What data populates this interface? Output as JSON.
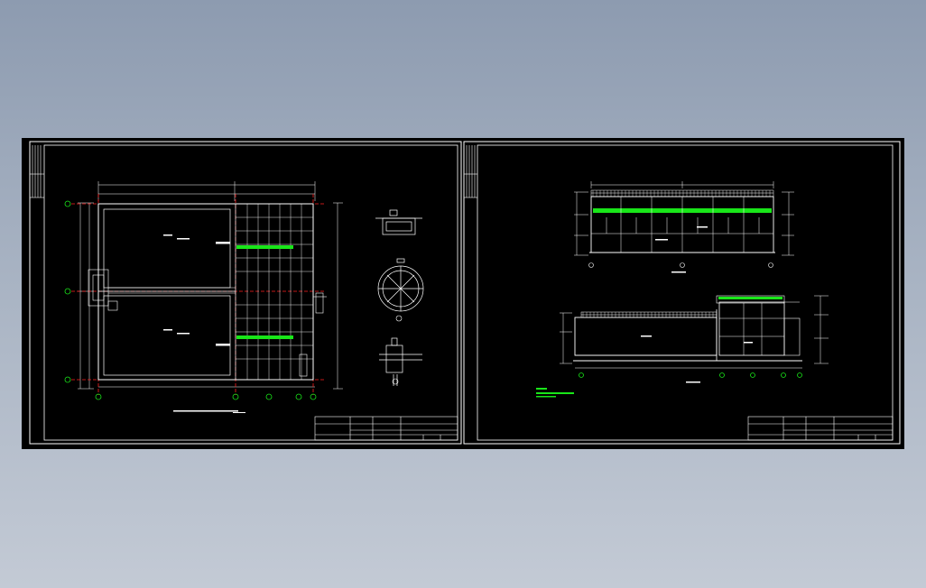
{
  "colors": {
    "background_top": "#8d9bb0",
    "background_bottom": "#c3cad5",
    "canvas": "#000000",
    "frame": "#ffffff",
    "axis_lines": "#ff2020",
    "fill_highlight": "#19e619",
    "annotation_text": "#19e619"
  },
  "icons": {
    "detail_circle": "circle-detail-icon",
    "axis_bubble": "axis-bubble-icon"
  },
  "sheets": [
    {
      "id": "sheet-1",
      "content": "tank-plan",
      "details": [
        "section-detail",
        "circular-manhole-detail",
        "pipe-fitting-detail"
      ]
    },
    {
      "id": "sheet-2",
      "content": "tank-elevations",
      "views": [
        "longitudinal-section",
        "cross-section"
      ]
    }
  ]
}
